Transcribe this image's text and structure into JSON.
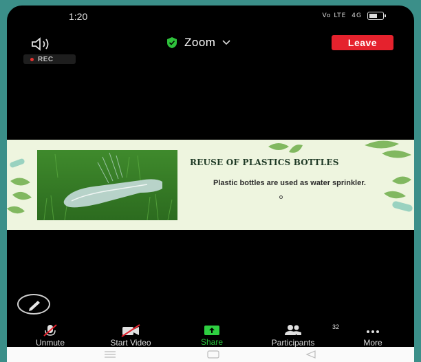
{
  "status_bar": {
    "time": "1:20",
    "signal_text": "Vo LTE",
    "network_text": "4G"
  },
  "top_bar": {
    "app_title": "Zoom",
    "leave_label": "Leave"
  },
  "recording": {
    "label": "REC"
  },
  "slide": {
    "title": "REUSE OF PLASTICS BOTTLES",
    "body": "Plastic bottles are used as water sprinkler."
  },
  "toolbar": {
    "unmute_label": "Unmute",
    "start_video_label": "Start Video",
    "share_label": "Share",
    "participants_label": "Participants",
    "participants_count": "32",
    "more_label": "More"
  },
  "colors": {
    "leave_button": "#e5222d",
    "share_accent": "#2ecf41",
    "secure_shield": "#2ec13b",
    "recording_dot": "#e6322f",
    "slide_background": "#eef5df"
  },
  "icons": [
    "speaker-icon",
    "shield-icon",
    "chevron-down-icon",
    "pen-icon",
    "mic-off-icon",
    "video-off-icon",
    "share-icon",
    "participants-icon",
    "more-icon",
    "menu-nav-icon",
    "home-nav-icon",
    "back-nav-icon"
  ]
}
